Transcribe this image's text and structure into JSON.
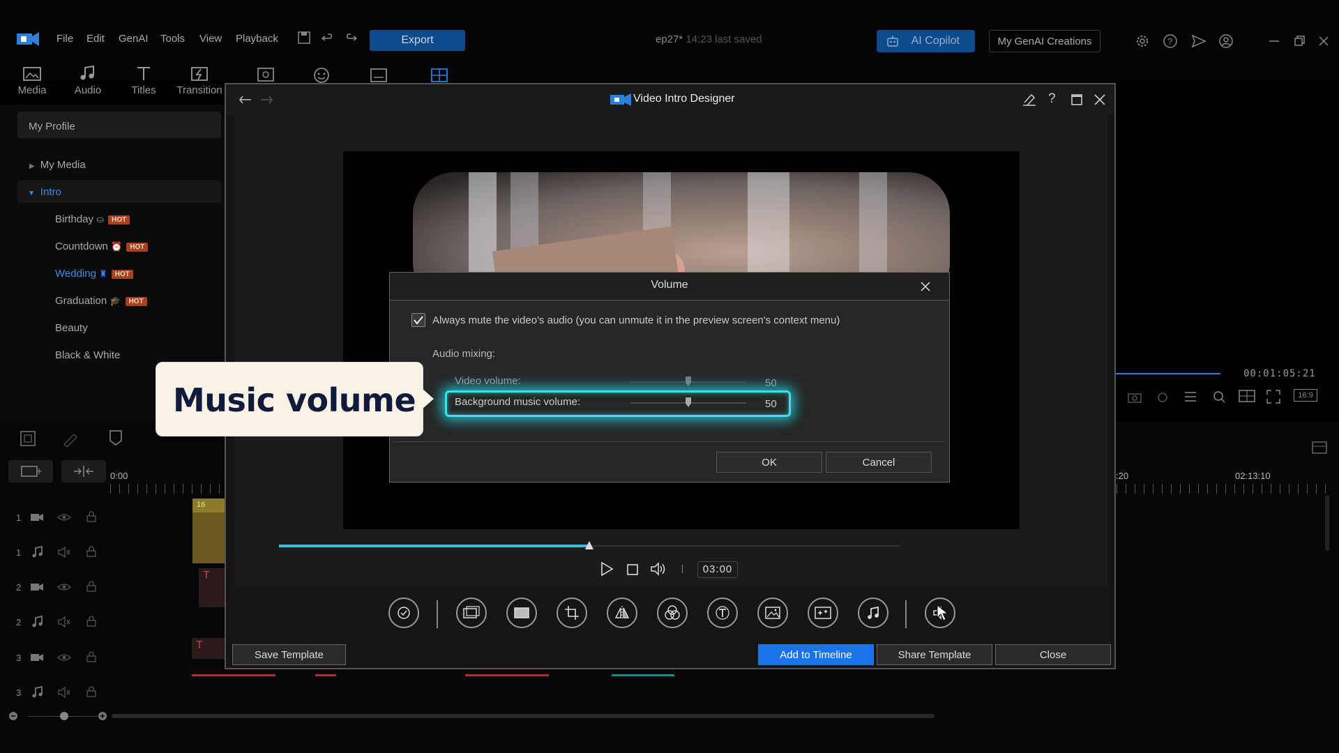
{
  "app": {
    "menu": [
      "File",
      "Edit",
      "GenAI",
      "Tools",
      "View",
      "Playback"
    ],
    "export_label": "Export",
    "project_name": "ep27*",
    "last_saved": "14:23 last saved",
    "copilot_label": "AI Copilot",
    "genai_creations_label": "My GenAI Creations"
  },
  "tabs": [
    "Media",
    "Audio",
    "Titles",
    "Transition"
  ],
  "left_panel": {
    "profile": "My Profile",
    "my_media": "My Media",
    "intro": "Intro",
    "items": [
      {
        "label": "Birthday",
        "hot": "HOT"
      },
      {
        "label": "Countdown",
        "hot": "HOT"
      },
      {
        "label": "Wedding",
        "hot": "HOT"
      },
      {
        "label": "Graduation",
        "hot": "HOT"
      },
      {
        "label": "Beauty",
        "hot": ""
      },
      {
        "label": "Black & White",
        "hot": ""
      }
    ]
  },
  "timeline": {
    "start_time": "0:00",
    "time_20": ":20",
    "time_end": "02:13:10",
    "clip_label": "16",
    "tracks": [
      "1",
      "1",
      "2",
      "2",
      "3",
      "3"
    ],
    "timecode": "00:01:05:21",
    "aspect": "16:9"
  },
  "designer": {
    "title": "Video Intro Designer",
    "timecode": "03:00",
    "progress": 0.5,
    "save_template": "Save Template",
    "add_to_timeline": "Add to Timeline",
    "share_template": "Share Template",
    "close": "Close",
    "accent": "#1a73e8"
  },
  "volume_dialog": {
    "title": "Volume",
    "mute_label": "Always mute the video's audio (you can unmute it in the preview screen's context menu)",
    "audio_mixing": "Audio mixing:",
    "video_volume_label": "Video volume:",
    "video_volume": 50,
    "bg_music_label": "Background music volume:",
    "bg_music_volume": 50,
    "ok": "OK",
    "cancel": "Cancel",
    "highlight_color": "#2ee8f0"
  },
  "callout": {
    "text": "Music volume"
  }
}
